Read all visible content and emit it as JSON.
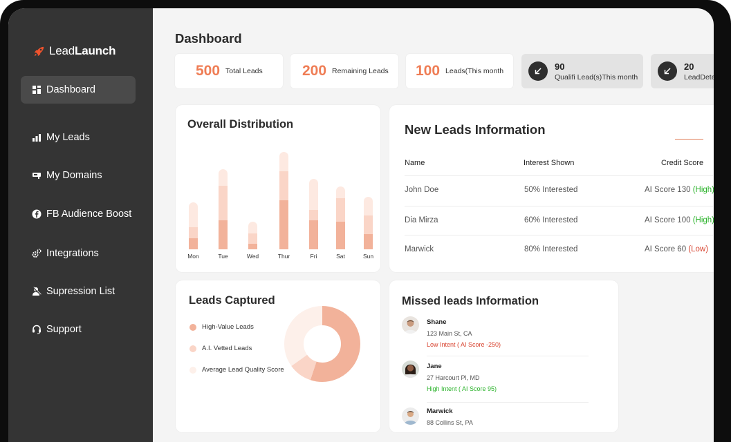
{
  "app": {
    "brand_regular": "Lead",
    "brand_bold": "Launch"
  },
  "sidebar": {
    "items": [
      {
        "label": "Dashboard",
        "icon": "grid-icon"
      },
      {
        "label": "My Leads",
        "icon": "bar-chart-icon"
      },
      {
        "label": "My Domains",
        "icon": "domain-icon"
      },
      {
        "label": "FB Audience Boost",
        "icon": "facebook-icon"
      },
      {
        "label": "Integrations",
        "icon": "cogs-icon"
      },
      {
        "label": "Supression List",
        "icon": "user-block-icon"
      },
      {
        "label": "Support",
        "icon": "headset-icon"
      }
    ]
  },
  "page": {
    "title": "Dashboard"
  },
  "stats": [
    {
      "value": "500",
      "label": "Total Leads"
    },
    {
      "value": "200",
      "label": "Remaining Leads"
    },
    {
      "value": "100",
      "label": "Leads(This month"
    },
    {
      "value": "90",
      "label": "Qualifi Lead(s)This month"
    },
    {
      "value": "20",
      "label": "LeadDete"
    }
  ],
  "distribution": {
    "title": "Overall Distribution",
    "colors": {
      "dark": "#f2b29a",
      "mid": "#fad5c7",
      "light": "#fde9e1"
    }
  },
  "chart_data": {
    "type": "bar",
    "categories": [
      "Mon",
      "Tue",
      "Wed",
      "Thur",
      "Fri",
      "Sat",
      "Sun"
    ],
    "series": [
      {
        "values": [
          16,
          42,
          8,
          71,
          42,
          40,
          22
        ]
      },
      {
        "values": [
          16,
          50,
          15,
          42,
          15,
          34,
          27
        ]
      },
      {
        "values": [
          36,
          24,
          17,
          28,
          45,
          17,
          27
        ]
      }
    ]
  },
  "new_leads": {
    "title": "New Leads Information",
    "accent": "#e07b54",
    "columns": [
      "Name",
      "Interest Shown",
      "Credit Score"
    ],
    "rows": [
      {
        "name": "John Doe",
        "interest": "50% Interested",
        "score": "AI Score 130",
        "level": "(High)"
      },
      {
        "name": "Dia Mirza",
        "interest": "60% Interested",
        "score": "AI Score 100",
        "level": "(High)"
      },
      {
        "name": "Marwick",
        "interest": "80% Interested",
        "score": "AI Score 60",
        "level": "(Low)"
      }
    ]
  },
  "leads_captured": {
    "title": "Leads Captured",
    "legend": [
      {
        "label": "High-Value Leads",
        "color": "#f2b29a"
      },
      {
        "label": "A.I. Vetted Leads",
        "color": "#fad5c7"
      },
      {
        "label": "Average Lead Quality Score",
        "color": "#fdf0ea"
      }
    ],
    "donut": [
      {
        "share": 0.55,
        "color": "#f2b29a"
      },
      {
        "share": 0.1,
        "color": "#fad5c7"
      },
      {
        "share": 0.35,
        "color": "#fdf0ea"
      }
    ]
  },
  "missed_leads": {
    "title": "Missed leads Information",
    "items": [
      {
        "name": "Shane",
        "address": "123 Main St, CA",
        "intent": "Low Intent ( AI Score -250)",
        "level": "low"
      },
      {
        "name": "Jane",
        "address": "27 Harcourt Pl, MD",
        "intent": "High Intent ( AI Score 95)",
        "level": "high"
      },
      {
        "name": "Marwick",
        "address": "88 Collins St, PA",
        "intent": "",
        "level": ""
      }
    ]
  }
}
